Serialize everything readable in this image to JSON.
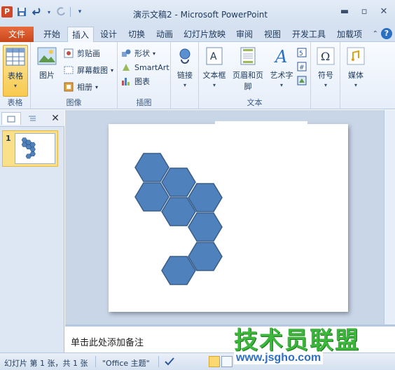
{
  "window": {
    "title": "演示文稿2 - Microsoft PowerPoint",
    "app_icon_letter": "P",
    "controls": [
      "minimize",
      "restore",
      "close"
    ]
  },
  "quick_access": {
    "items": [
      "save-icon",
      "undo-icon",
      "redo-icon",
      "customize-icon"
    ]
  },
  "tabs": {
    "file": "文件",
    "items": [
      "开始",
      "插入",
      "设计",
      "切换",
      "动画",
      "幻灯片放映",
      "审阅",
      "视图",
      "开发工具",
      "加载项"
    ],
    "active": "插入"
  },
  "ribbon": {
    "groups": {
      "tables": {
        "label": "表格",
        "table_btn": "表格"
      },
      "images": {
        "label": "图像",
        "picture_btn": "图片",
        "clipart_btn": "剪贴画",
        "screenshot_btn": "屏幕截图",
        "album_btn": "相册"
      },
      "illustrations": {
        "label": "插图",
        "shapes_btn": "形状",
        "smartart_btn": "SmartArt",
        "chart_btn": "图表"
      },
      "links": {
        "link_btn": "链接"
      },
      "text": {
        "label": "文本",
        "textbox_btn": "文本框",
        "headerfooter_btn": "页眉和页脚",
        "wordart_btn": "艺术字"
      },
      "symbols": {
        "symbol_btn": "符号"
      },
      "media": {
        "media_btn": "媒体"
      }
    }
  },
  "slide_panel": {
    "slide_number": "1"
  },
  "notes": {
    "placeholder": "单击此处添加备注"
  },
  "status": {
    "slide_info": "幻灯片 第 1 张，共 1 张",
    "theme": "\"Office 主题\"",
    "language_icon": "proofing-icon"
  },
  "watermark": {
    "text": "技术员联盟",
    "url": "www.jsgho.com"
  },
  "colors": {
    "hexagon_fill": "#4f81bd",
    "hexagon_stroke": "#385d8a",
    "file_tab": "#d24726",
    "watermark_green": "#3cb73c"
  }
}
